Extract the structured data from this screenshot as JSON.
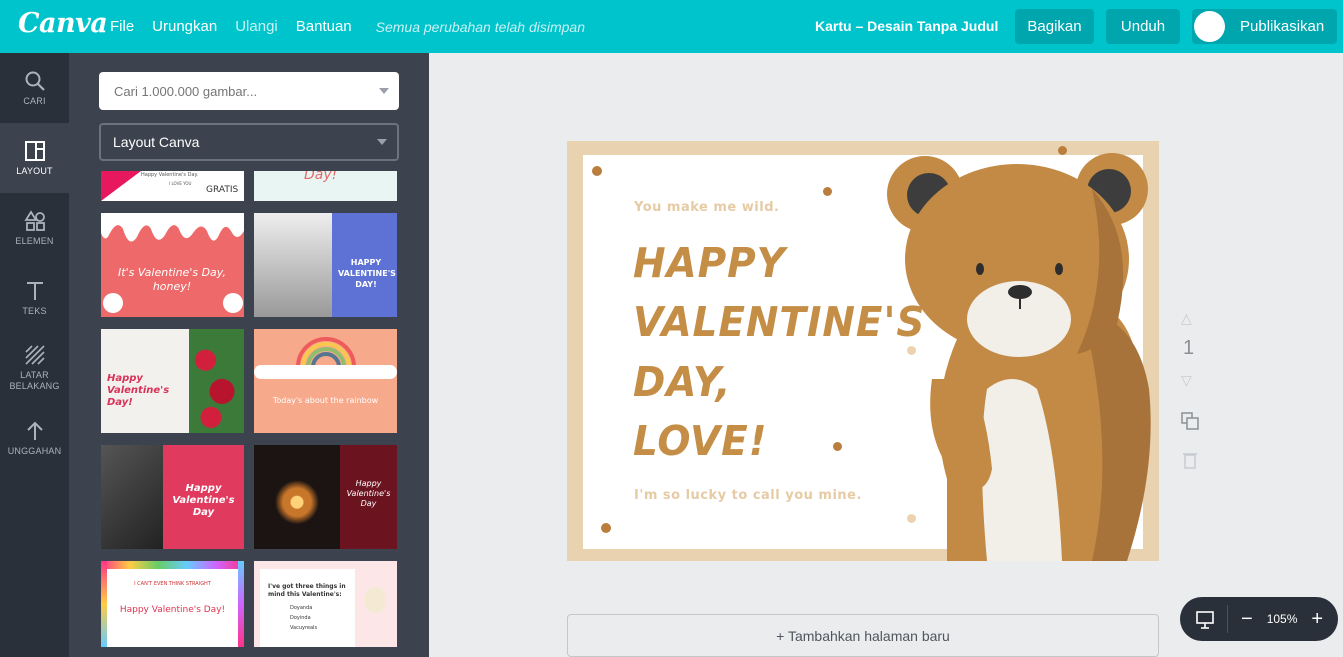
{
  "topbar": {
    "logo": "Canva",
    "menu": [
      "File",
      "Urungkan",
      "Ulangi",
      "Bantuan"
    ],
    "saved_status": "Semua perubahan telah disimpan",
    "doc_title": "Kartu – Desain Tanpa Judul",
    "share_label": "Bagikan",
    "download_label": "Unduh",
    "publish_label": "Publikasikan"
  },
  "rail": [
    {
      "label": "CARI",
      "icon": "search-icon"
    },
    {
      "label": "LAYOUT",
      "icon": "layout-icon"
    },
    {
      "label": "ELEMEN",
      "icon": "elements-icon"
    },
    {
      "label": "TEKS",
      "icon": "text-icon"
    },
    {
      "label": "LATAR BELAKANG",
      "icon": "background-icon"
    },
    {
      "label": "UNGGAHAN",
      "icon": "upload-icon"
    }
  ],
  "panel": {
    "search_placeholder": "Cari 1.000.000 gambar...",
    "layout_select": "Layout Canva",
    "thumbs": {
      "t0_line1": "Happy Valentine's Day.",
      "t0_line2": "I LOVE YOU",
      "t0_badge": "GRATIS",
      "t1_title": "Day!",
      "t2_title": "It's Valentine's Day, honey!",
      "t3_title": "HAPPY VALENTINE'S DAY!",
      "t4_title": "Happy Valentine's Day!",
      "t5_title": "Today's about the rainbow",
      "t6_title": "Happy Valentine's Day",
      "t7_title": "Happy Valentine's Day",
      "t8_top": "I CAN'T EVEN THINK STRAIGHT",
      "t8_title": "Happy Valentine's Day!",
      "t9_title": "I've got three things in mind this Valentine's:",
      "t9_items": [
        "Doyanda",
        "Doyinda",
        "Vacuyreals"
      ]
    }
  },
  "card": {
    "subtitle": "You make me wild.",
    "line1": "HAPPY",
    "line2": "VALENTINE'S",
    "line3": "DAY,",
    "line4": "LOVE!",
    "footer": "I'm so lucky to call you mine."
  },
  "page_number": "1",
  "add_page_label": "+ Tambahkan halaman baru",
  "zoom": "105%",
  "colors": {
    "topbar": "#00c4cc",
    "rail": "#293039",
    "panel": "#3c434e",
    "card_frame": "#e9d2b0",
    "title_brown": "#c58e47",
    "bear": "#c28a45"
  }
}
